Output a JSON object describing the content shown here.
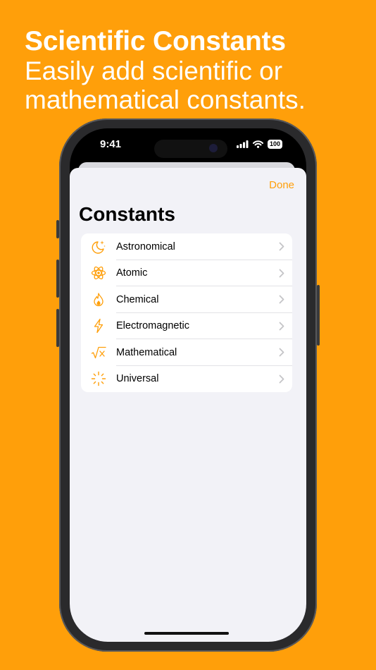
{
  "headline": {
    "title": "Scientific Constants",
    "subtitle_line1": "Easily add scientific or",
    "subtitle_line2": "mathematical constants."
  },
  "status_bar": {
    "time": "9:41",
    "battery": "100"
  },
  "sheet": {
    "done_label": "Done",
    "title": "Constants",
    "items": [
      {
        "label": "Astronomical",
        "icon": "moon-stars-icon"
      },
      {
        "label": "Atomic",
        "icon": "atom-icon"
      },
      {
        "label": "Chemical",
        "icon": "flame-icon"
      },
      {
        "label": "Electromagnetic",
        "icon": "bolt-icon"
      },
      {
        "label": "Mathematical",
        "icon": "square-root-icon"
      },
      {
        "label": "Universal",
        "icon": "sparkle-rays-icon"
      }
    ]
  },
  "colors": {
    "accent": "#ff9f0a",
    "background": "#ff9f0a",
    "sheet": "#f2f2f7"
  }
}
